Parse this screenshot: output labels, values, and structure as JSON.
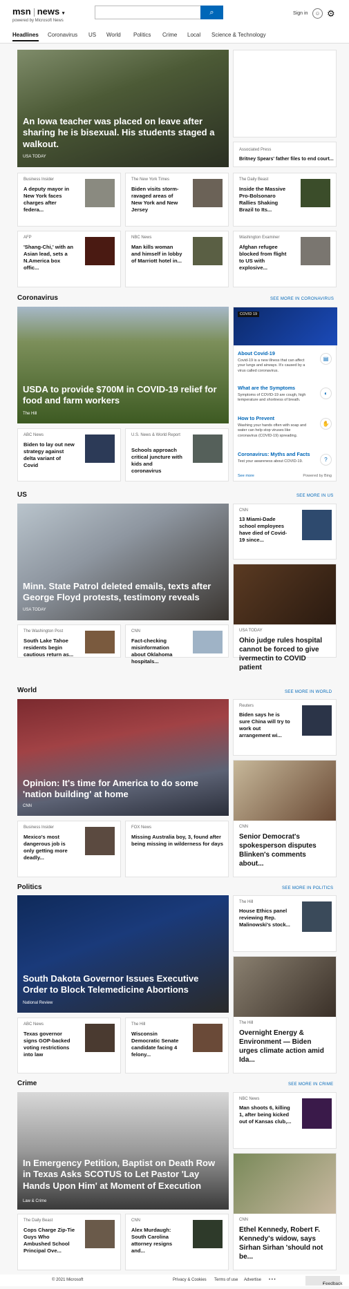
{
  "header": {
    "logo": "msn",
    "brand": "news",
    "powered": "powered by Microsoft News",
    "signin": "Sign in"
  },
  "nav": [
    "Headlines",
    "Coronavirus",
    "US",
    "World",
    "Politics",
    "Crime",
    "Local",
    "Science & Technology"
  ],
  "top": {
    "hero": {
      "title": "An Iowa teacher was placed on leave after sharing he is bisexual. His students staged a walkout.",
      "source": "USA TODAY"
    },
    "side": {
      "source": "Associated Press",
      "title": "Britney Spears' father files to end court..."
    },
    "cards": [
      {
        "source": "Business Insider",
        "title": "A deputy mayor in New York faces charges after federa..."
      },
      {
        "source": "The New York Times",
        "title": "Biden visits storm-ravaged areas of New York and New Jersey"
      },
      {
        "source": "The Daily Beast",
        "title": "Inside the Massive Pro-Bolsonaro Rallies Shaking Brazil to Its..."
      },
      {
        "source": "AFP",
        "title": "'Shang-Chi,' with an Asian lead, sets a N.America box offic..."
      },
      {
        "source": "NBC News",
        "title": "Man kills woman and himself in lobby of Marriott hotel in..."
      },
      {
        "source": "Washington Examiner",
        "title": "Afghan refugee blocked from flight to US with explosive..."
      }
    ]
  },
  "coronavirus": {
    "title": "Coronavirus",
    "more": "SEE MORE IN CORONAVIRUS",
    "hero": {
      "title": "USDA to provide $700M in COVID-19 relief for food and farm workers",
      "source": "The Hill"
    },
    "cards": [
      {
        "source": "ABC News",
        "title": "Biden to lay out new strategy against delta variant of Covid"
      },
      {
        "source": "U.S. News & World Report",
        "title": "Schools approach critical juncture with kids and coronavirus"
      }
    ],
    "widget": {
      "tag": "COVID 19",
      "items": [
        {
          "title": "About Covid-19",
          "text": "Covid-19 is a new illness that can affect your lungs and airways. It's caused by a virus called coronavirus."
        },
        {
          "title": "What are the Symptoms",
          "text": "Symptoms of COVID-19 are cough, high temperature and shortness of breath."
        },
        {
          "title": "How to Prevent",
          "text": "Washing your hands often with soap and water can help stop viruses like coronavirus (COVID-19) spreading."
        },
        {
          "title": "Coronavirus: Myths and Facts",
          "text": "Test your awareness about COVID-19."
        }
      ],
      "see_more": "See more",
      "powered": "Powered by Bing"
    }
  },
  "us": {
    "title": "US",
    "more": "SEE MORE IN US",
    "hero": {
      "title": "Minn. State Patrol deleted emails, texts after George Floyd protests, testimony reveals",
      "source": "USA TODAY"
    },
    "side1": {
      "source": "CNN",
      "title": "13 Miami-Dade school employees have died of Covid-19 since..."
    },
    "side2": {
      "source": "USA TODAY",
      "title": "Ohio judge rules hospital cannot be forced to give ivermectin to COVID patient"
    },
    "cards": [
      {
        "source": "The Washington Post",
        "title": "South Lake Tahoe residents begin cautious return as..."
      },
      {
        "source": "CNN",
        "title": "Fact-checking misinformation about Oklahoma hospitals..."
      }
    ]
  },
  "world": {
    "title": "World",
    "more": "SEE MORE IN WORLD",
    "hero": {
      "title": "Opinion: It's time for America to do some 'nation building' at home",
      "source": "CNN"
    },
    "side1": {
      "source": "Reuters",
      "title": "Biden says he is sure China will try to work out arrangement wi..."
    },
    "side2": {
      "source": "CNN",
      "title": "Senior Democrat's spokesperson disputes Blinken's comments about..."
    },
    "cards": [
      {
        "source": "Business Insider",
        "title": "Mexico's most dangerous job is only getting more deadly..."
      },
      {
        "source": "FOX News",
        "title": "Missing Australia boy, 3, found after being missing in wilderness for days"
      }
    ]
  },
  "politics": {
    "title": "Politics",
    "more": "SEE MORE IN POLITICS",
    "hero": {
      "title": "South Dakota Governor Issues Executive Order to Block Telemedicine Abortions",
      "source": "National Review"
    },
    "side1": {
      "source": "The Hill",
      "title": "House Ethics panel reviewing Rep. Malinowski's stock..."
    },
    "side2": {
      "source": "The Hill",
      "title": "Overnight Energy & Environment — Biden urges climate action amid Ida..."
    },
    "cards": [
      {
        "source": "ABC News",
        "title": "Texas governor signs GOP-backed voting restrictions into law"
      },
      {
        "source": "The Hill",
        "title": "Wisconsin Democratic Senate candidate facing 4 felony..."
      }
    ]
  },
  "crime": {
    "title": "Crime",
    "more": "SEE MORE IN CRIME",
    "hero": {
      "title": "In Emergency Petition, Baptist on Death Row in Texas Asks SCOTUS to Let Pastor 'Lay Hands Upon Him' at Moment of Execution",
      "source": "Law & Crime"
    },
    "side1": {
      "source": "NBC News",
      "title": "Man shoots 6, killing 1, after being kicked out of Kansas club,..."
    },
    "side2": {
      "source": "CNN",
      "title": "Ethel Kennedy, Robert F. Kennedy's widow, says Sirhan Sirhan 'should not be..."
    },
    "cards": [
      {
        "source": "The Daily Beast",
        "title": "Cops Charge Zip-Tie Guys Who Ambushed School Principal Ove..."
      },
      {
        "source": "CNN",
        "title": "Alex Murdaugh: South Carolina attorney resigns and..."
      }
    ]
  },
  "footer": {
    "copyright": "© 2021 Microsoft",
    "privacy": "Privacy & Cookies",
    "terms": "Terms of use",
    "advertise": "Advertise",
    "more": "• • •",
    "feedback": "Feedback"
  }
}
